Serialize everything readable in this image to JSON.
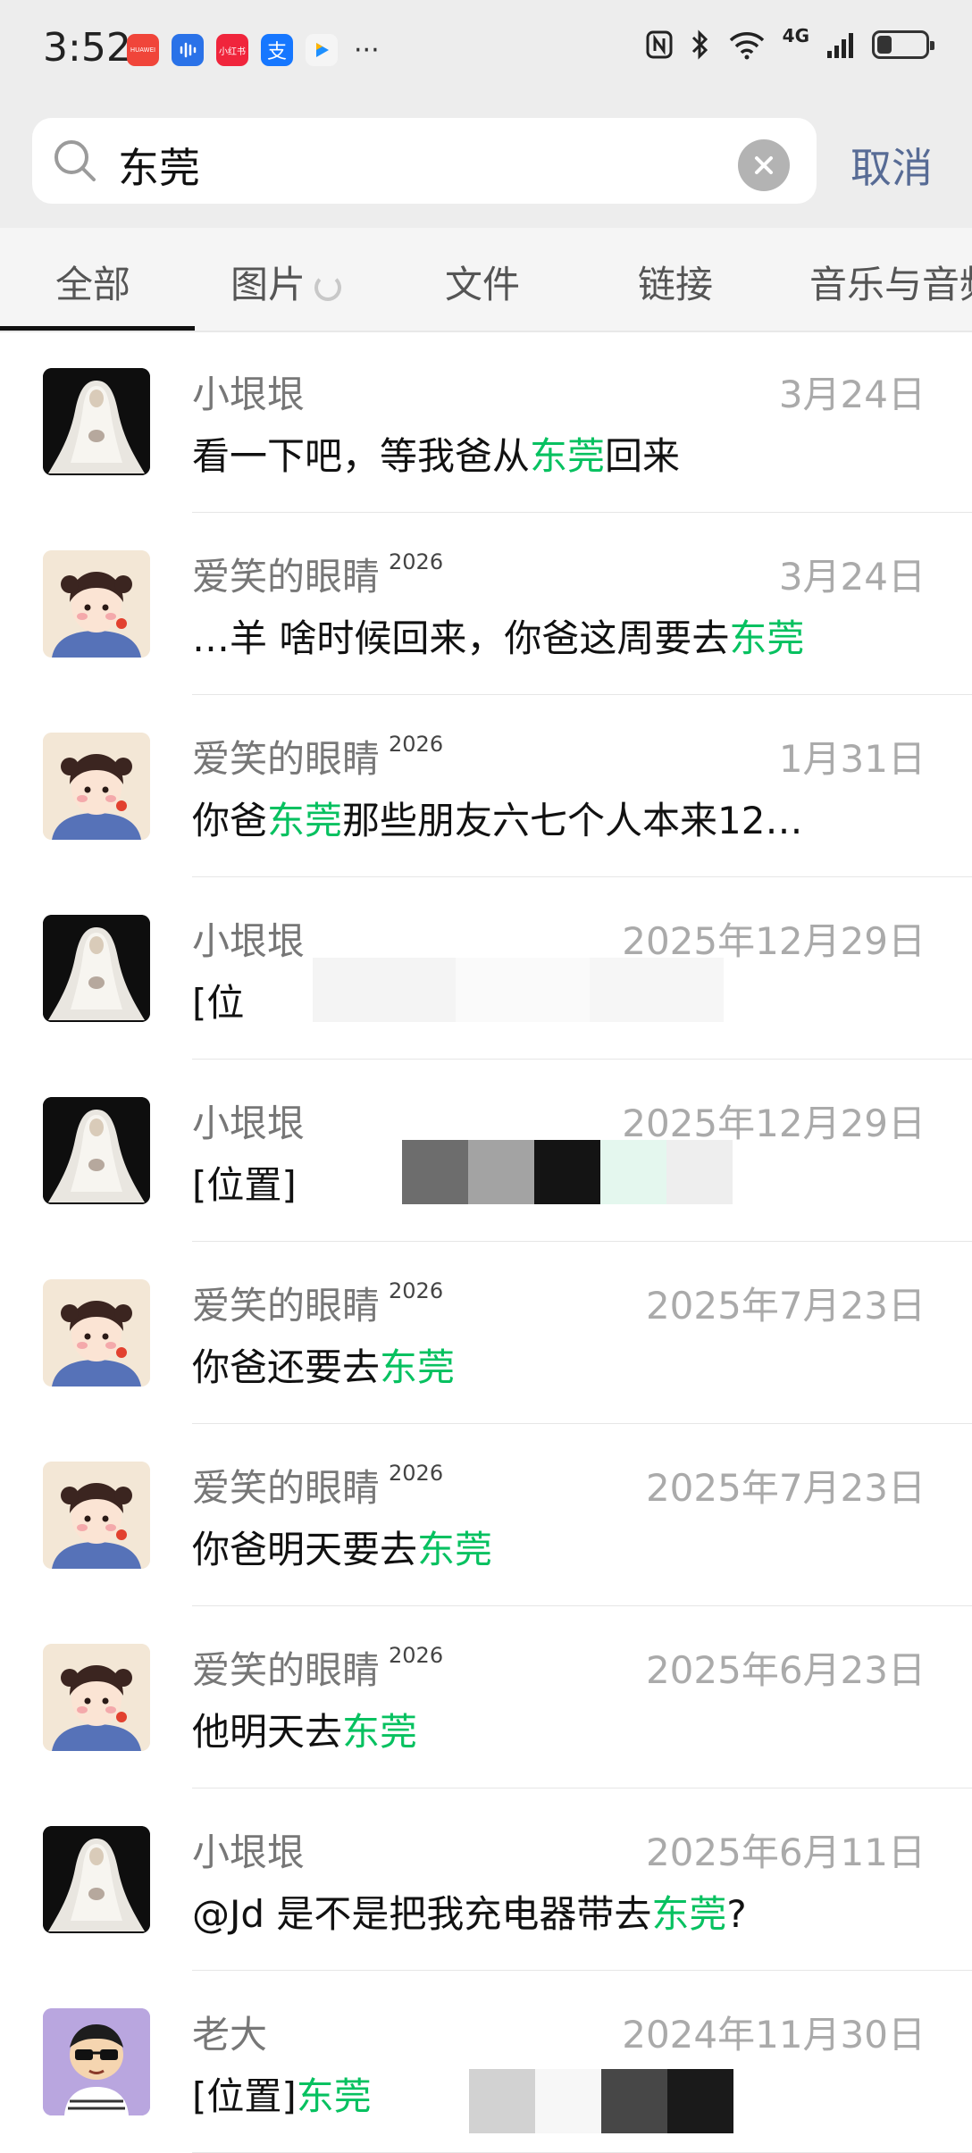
{
  "status_bar": {
    "time": "3:52",
    "app_icons": [
      {
        "name": "huawei-app-icon",
        "color": "#f0453a",
        "label": "HUAWEI"
      },
      {
        "name": "voice-app-icon",
        "color": "#2a72e8",
        "label": ""
      },
      {
        "name": "xiaohongshu-app-icon",
        "color": "#f0253c",
        "label": "小红书"
      },
      {
        "name": "alipay-app-icon",
        "color": "#1677ff",
        "label": "支"
      },
      {
        "name": "video-app-icon",
        "color": "#f5f5f5",
        "label": ""
      }
    ],
    "more": "···",
    "network": "4G",
    "battery_level": 0.3
  },
  "search": {
    "query": "东莞",
    "cancel_label": "取消"
  },
  "tabs": [
    {
      "label": "全部",
      "active": true
    },
    {
      "label": "图片",
      "active": false,
      "loading": true
    },
    {
      "label": "文件",
      "active": false
    },
    {
      "label": "链接",
      "active": false
    },
    {
      "label": "音乐与音频",
      "active": false
    }
  ],
  "results": [
    {
      "name": "小垠垠",
      "badge": "",
      "date": "3月24日",
      "avatar": "bride",
      "msg_before": "看一下吧，等我爸从",
      "msg_hl": "东莞",
      "msg_after": "回来"
    },
    {
      "name": "爱笑的眼睛",
      "badge": "2026",
      "date": "3月24日",
      "avatar": "girl",
      "msg_before": "…羊 啥时候回来，你爸这周要去",
      "msg_hl": "东莞",
      "msg_after": ""
    },
    {
      "name": "爱笑的眼睛",
      "badge": "2026",
      "date": "1月31日",
      "avatar": "girl",
      "msg_before": "你爸",
      "msg_hl": "东莞",
      "msg_after": "那些朋友六七个人本来12…"
    },
    {
      "name": "小垠垠",
      "badge": "",
      "date": "2025年12月29日",
      "avatar": "bride",
      "msg_before": "[位",
      "msg_hl": "",
      "msg_after": ""
    },
    {
      "name": "小垠垠",
      "badge": "",
      "date": "2025年12月29日",
      "avatar": "bride",
      "msg_before": "[位置]",
      "msg_hl": "",
      "msg_after": ""
    },
    {
      "name": "爱笑的眼睛",
      "badge": "2026",
      "date": "2025年7月23日",
      "avatar": "girl",
      "msg_before": "你爸还要去",
      "msg_hl": "东莞",
      "msg_after": ""
    },
    {
      "name": "爱笑的眼睛",
      "badge": "2026",
      "date": "2025年7月23日",
      "avatar": "girl",
      "msg_before": "你爸明天要去",
      "msg_hl": "东莞",
      "msg_after": ""
    },
    {
      "name": "爱笑的眼睛",
      "badge": "2026",
      "date": "2025年6月23日",
      "avatar": "girl",
      "msg_before": "他明天去",
      "msg_hl": "东莞",
      "msg_after": ""
    },
    {
      "name": "小垠垠",
      "badge": "",
      "date": "2025年6月11日",
      "avatar": "bride",
      "msg_before": "@Jd 是不是把我充电器带去",
      "msg_hl": "东莞",
      "msg_after": "?"
    },
    {
      "name": "老大",
      "badge": "",
      "date": "2024年11月30日",
      "avatar": "boss",
      "msg_before": "[位置]",
      "msg_hl": "东莞",
      "msg_after": ""
    }
  ]
}
